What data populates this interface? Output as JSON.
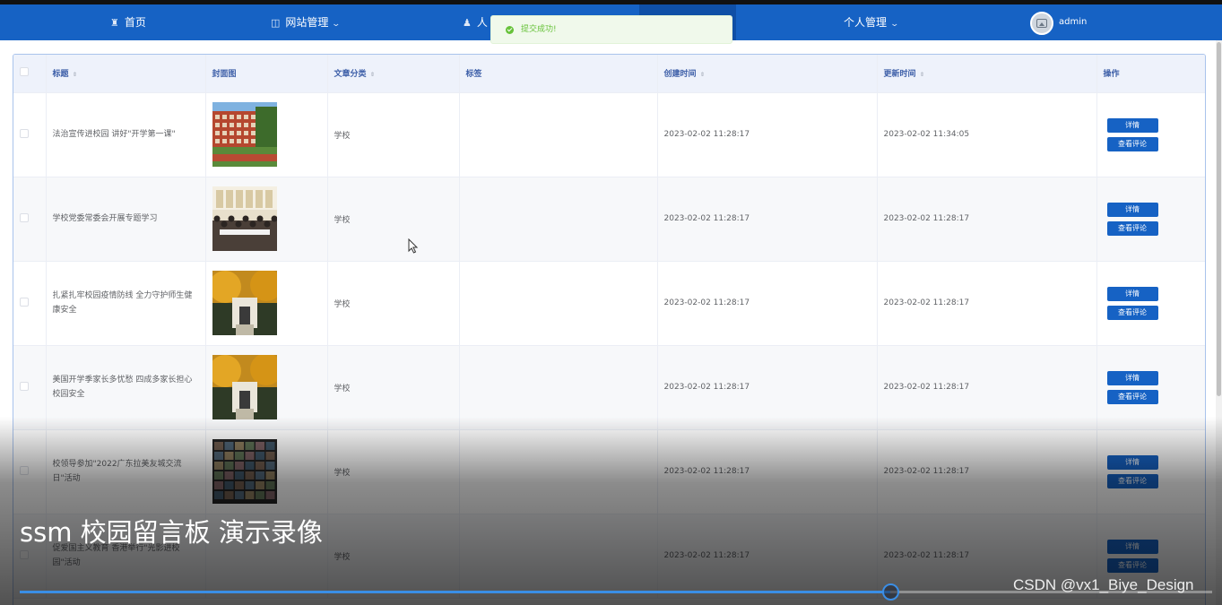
{
  "nav": {
    "home": "首页",
    "site_manage": "网站管理",
    "user_manage": "人",
    "personal_manage": "个人管理",
    "username": "admin",
    "colors": {
      "bar": "#1662c4",
      "active": "#0f4fa6"
    }
  },
  "toast": {
    "message": "提交成功!",
    "color": "#67c23a"
  },
  "table": {
    "columns": [
      "标题",
      "封面图",
      "文章分类",
      "标签",
      "创建时间",
      "更新时间",
      "操作"
    ],
    "rows": [
      {
        "title": "法治宣传进校园 讲好\"开学第一课\"",
        "category": "学校",
        "tag": "",
        "created": "2023-02-02 11:28:17",
        "updated": "2023-02-02 11:34:05",
        "cover": "building"
      },
      {
        "title": "学校党委常委会开展专题学习",
        "category": "学校",
        "tag": "",
        "created": "2023-02-02 11:28:17",
        "updated": "2023-02-02 11:28:17",
        "cover": "meeting"
      },
      {
        "title": "扎紧扎牢校园疫情防线 全力守护师生健康安全",
        "category": "学校",
        "tag": "",
        "created": "2023-02-02 11:28:17",
        "updated": "2023-02-02 11:28:17",
        "cover": "autumn-gate"
      },
      {
        "title": "美国开学季家长多忧愁 四成多家长担心校园安全",
        "category": "学校",
        "tag": "",
        "created": "2023-02-02 11:28:17",
        "updated": "2023-02-02 11:28:17",
        "cover": "autumn-gate"
      },
      {
        "title": "校领导参加\"2022广东拉美友城交流日\"活动",
        "category": "学校",
        "tag": "",
        "created": "2023-02-02 11:28:17",
        "updated": "2023-02-02 11:28:17",
        "cover": "video-call"
      },
      {
        "title": "促爱国主义教育 香港举行\"光影进校园\"活动",
        "category": "学校",
        "tag": "",
        "created": "2023-02-02 11:28:17",
        "updated": "2023-02-02 11:28:17",
        "cover": "none"
      }
    ],
    "detail_label": "详情",
    "comments_label": "查看评论"
  },
  "video": {
    "title": "ssm 校园留言板 演示录像",
    "progress": 0.73,
    "watermark": "CSDN @vx1_Biye_Design"
  }
}
